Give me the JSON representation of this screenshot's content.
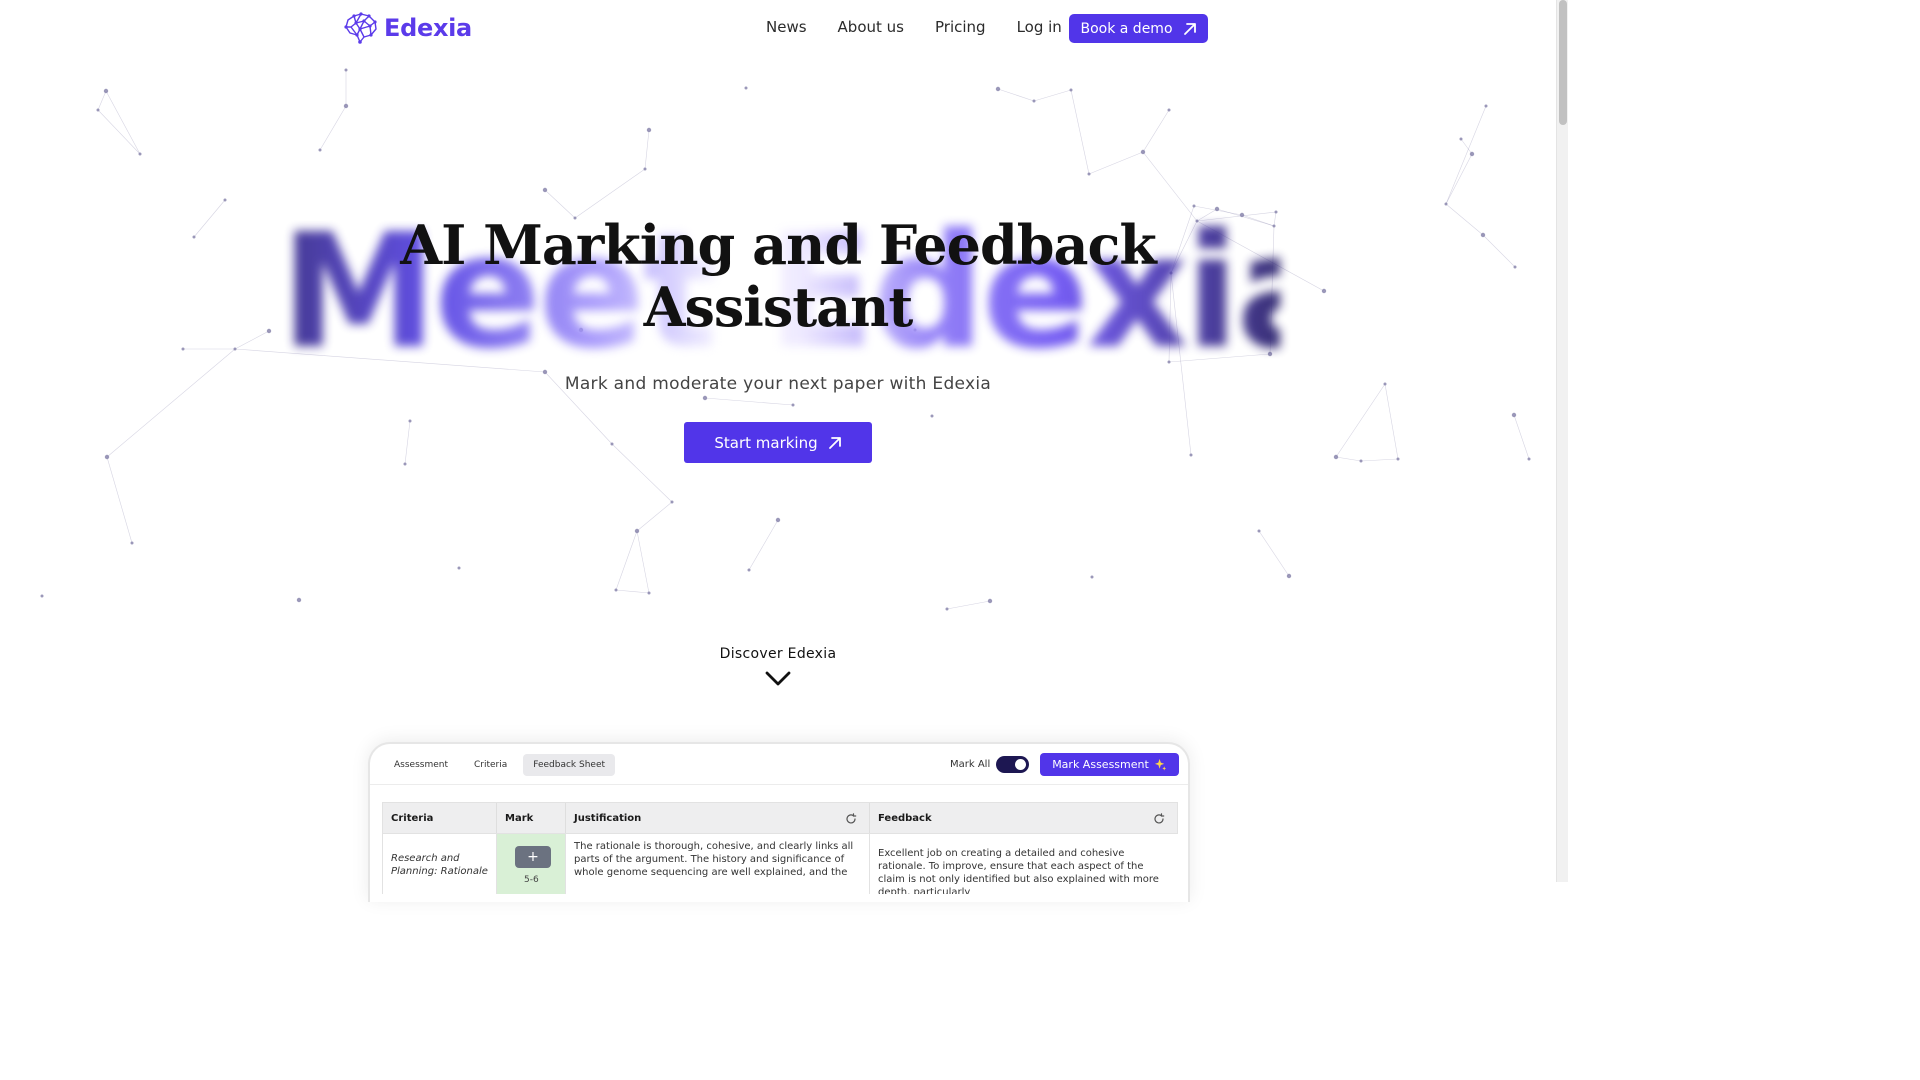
{
  "nav": {
    "brand": "Edexia",
    "links": [
      "News",
      "About us",
      "Pricing",
      "Log in"
    ],
    "cta": "Book a demo"
  },
  "hero": {
    "bg_text": "Meet Edexia",
    "title_line1": "AI Marking and Feedback",
    "title_line2": "Assistant",
    "subtitle": "Mark and moderate your next paper with Edexia",
    "cta": "Start marking"
  },
  "discover": "Discover Edexia",
  "preview": {
    "tabs": [
      "Assessment",
      "Criteria",
      "Feedback Sheet"
    ],
    "active_tab": "Feedback Sheet",
    "mark_all_label": "Mark All",
    "mark_all_on": true,
    "mark_button": "Mark Assessment",
    "columns": [
      "Criteria",
      "Mark",
      "Justification",
      "Feedback"
    ],
    "row": {
      "criteria": "Research and Planning: Rationale",
      "mark_button": "+",
      "mark_score": "5-6",
      "justification": "The rationale is thorough, cohesive, and clearly links all parts of the argument. The history and significance of whole genome sequencing are well explained, and the",
      "feedback": "Excellent job on creating a detailed and cohesive rationale. To improve, ensure that each aspect of the claim is not only identified but also explained with more depth, particularly"
    }
  },
  "colors": {
    "brand": "#5b3bea",
    "button": "#5135e9",
    "network": "#8a86ad"
  }
}
